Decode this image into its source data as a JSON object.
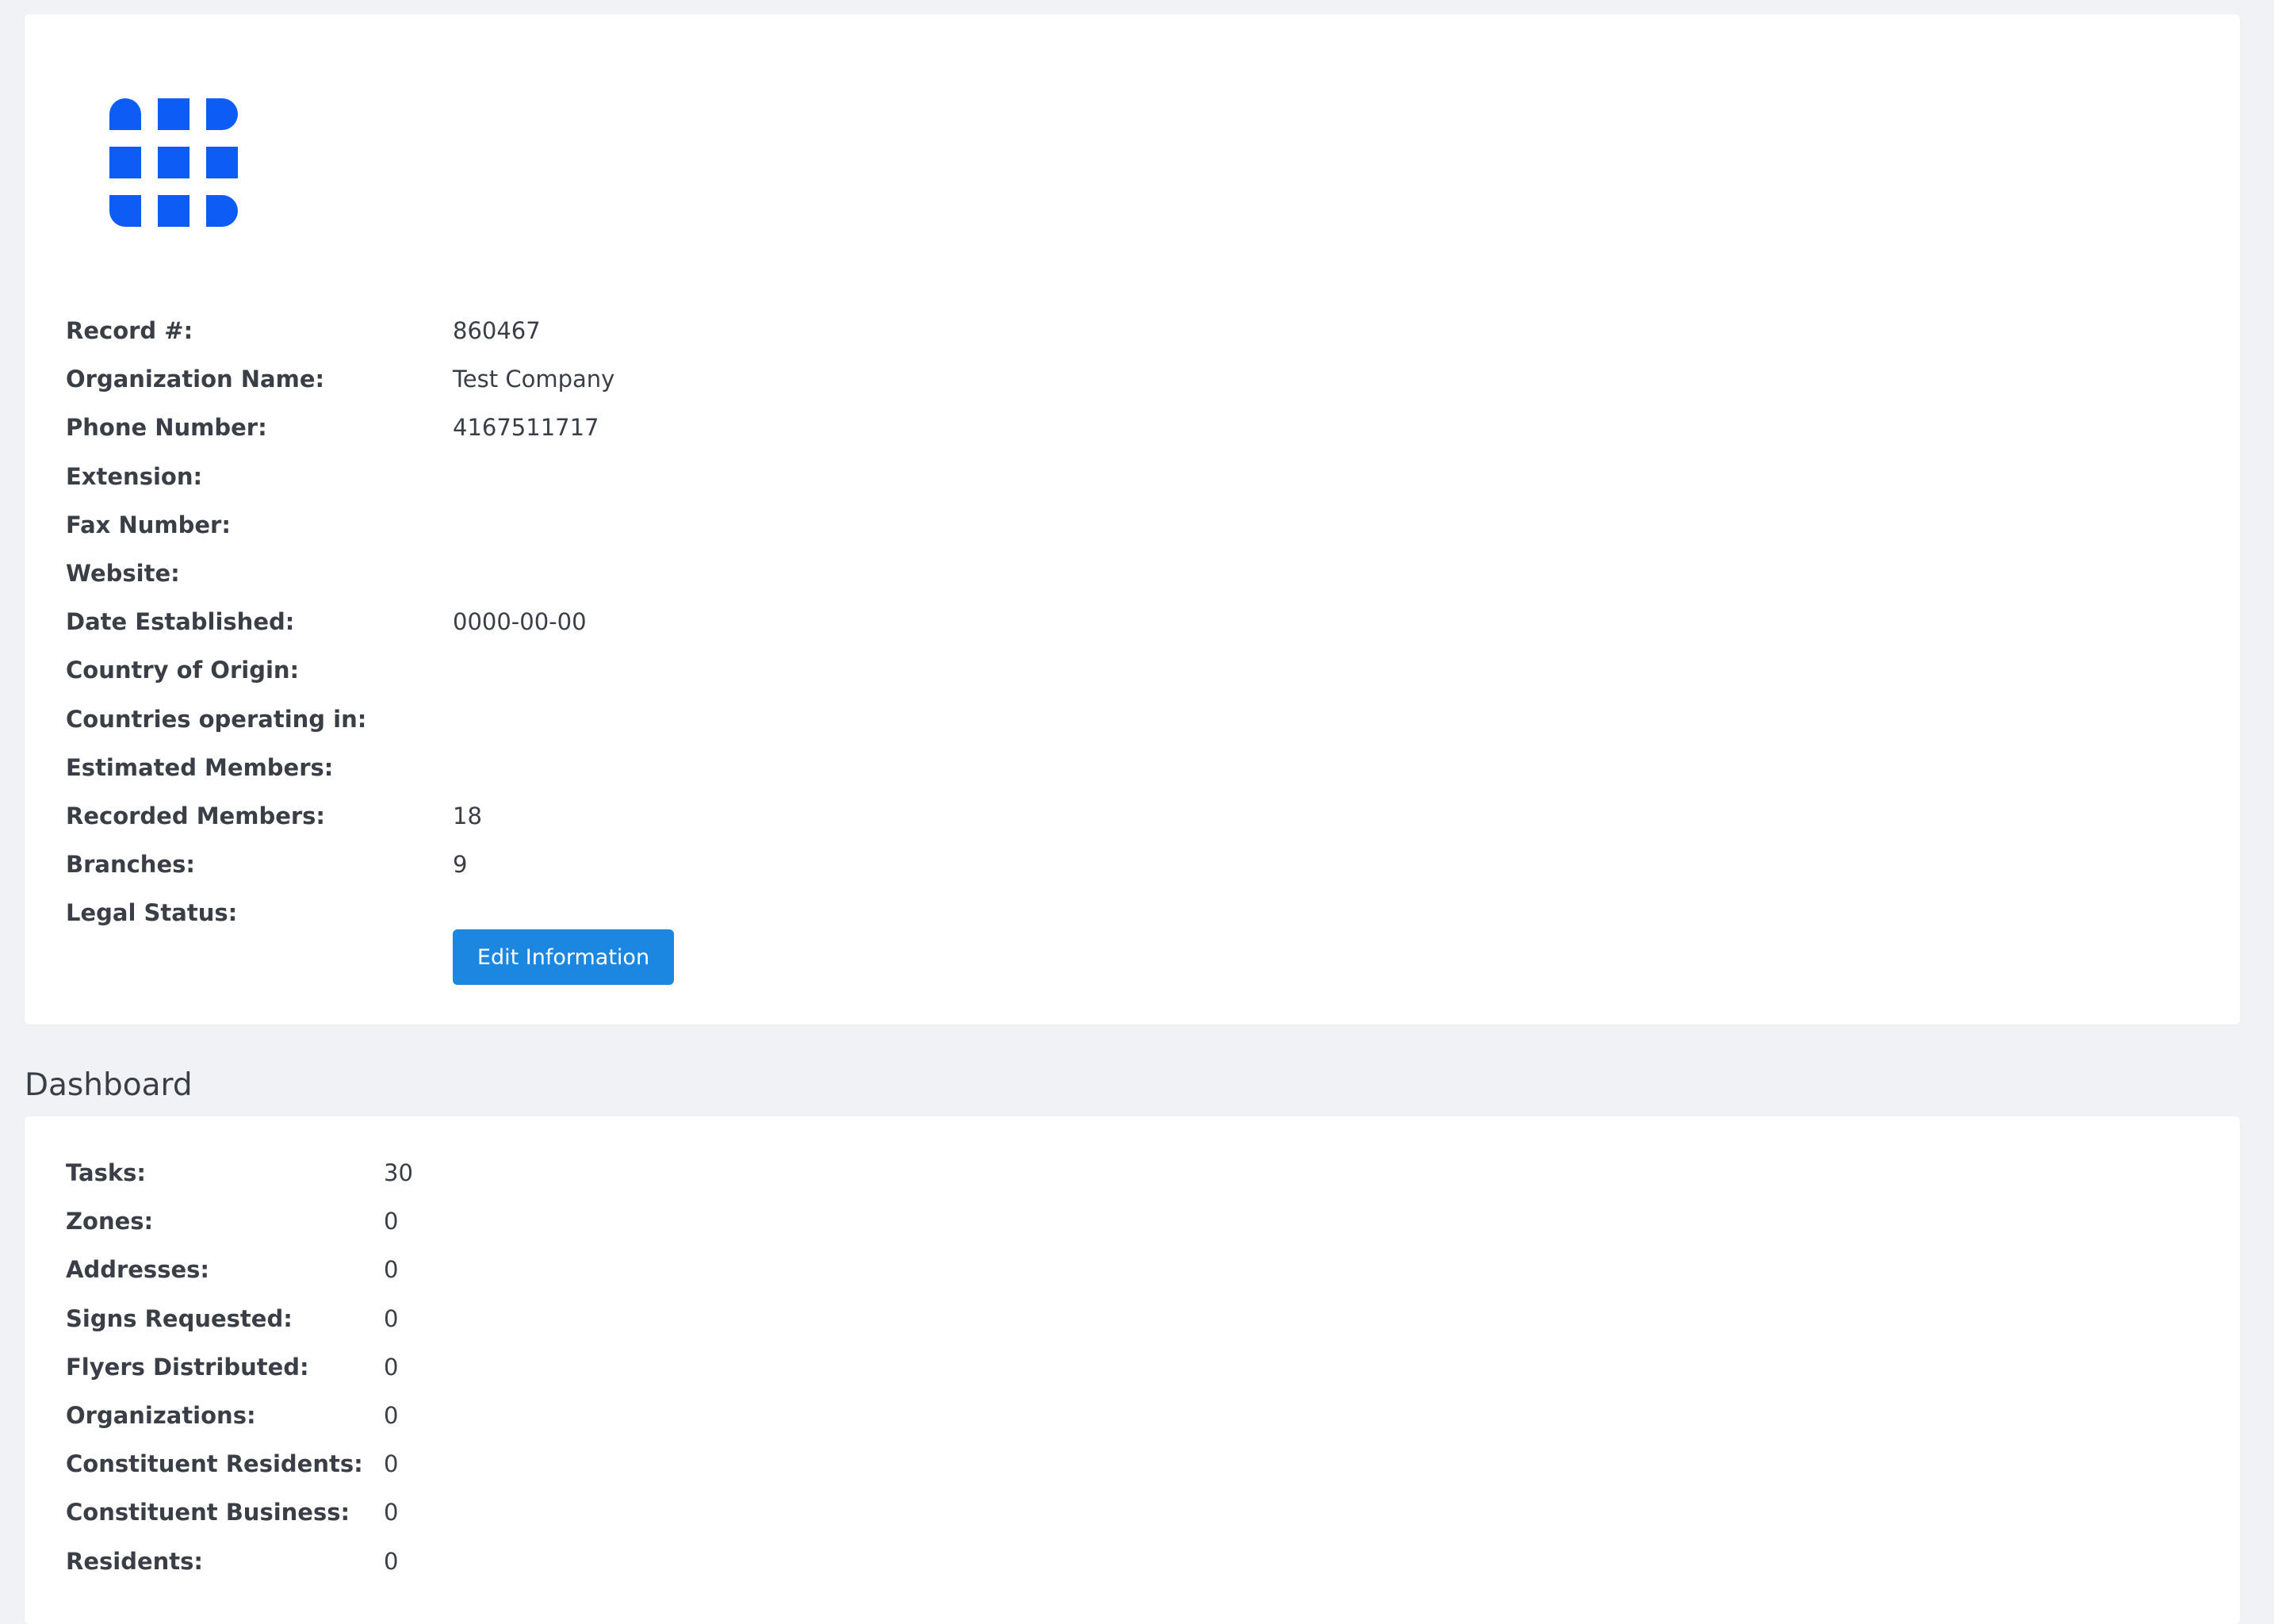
{
  "brand": {
    "accent": "#0d5cf5",
    "button": "#1c87e0"
  },
  "info": {
    "logo_icon": "grid-logo-icon",
    "fields": [
      {
        "label": "Record #:",
        "value": "860467"
      },
      {
        "label": "Organization Name:",
        "value": "Test Company"
      },
      {
        "label": "Phone Number:",
        "value": "4167511717"
      },
      {
        "label": "Extension:",
        "value": ""
      },
      {
        "label": "Fax Number:",
        "value": ""
      },
      {
        "label": "Website:",
        "value": ""
      },
      {
        "label": "Date Established:",
        "value": "0000-00-00"
      },
      {
        "label": "Country of Origin:",
        "value": ""
      },
      {
        "label": "Countries operating in:",
        "value": ""
      },
      {
        "label": "Estimated Members:",
        "value": ""
      },
      {
        "label": "Recorded Members:",
        "value": "18"
      },
      {
        "label": "Branches:",
        "value": "9"
      },
      {
        "label": "Legal Status:",
        "value": ""
      }
    ],
    "edit_label": "Edit Information"
  },
  "dashboard": {
    "title": "Dashboard",
    "fields": [
      {
        "label": "Tasks:",
        "value": "30"
      },
      {
        "label": "Zones:",
        "value": "0"
      },
      {
        "label": "Addresses:",
        "value": "0"
      },
      {
        "label": "Signs Requested:",
        "value": "0"
      },
      {
        "label": "Flyers Distributed:",
        "value": "0"
      },
      {
        "label": "Organizations:",
        "value": "0"
      },
      {
        "label": "Constituent Residents:",
        "value": "0"
      },
      {
        "label": "Constituent Business:",
        "value": "0"
      },
      {
        "label": "Residents:",
        "value": "0"
      }
    ]
  }
}
